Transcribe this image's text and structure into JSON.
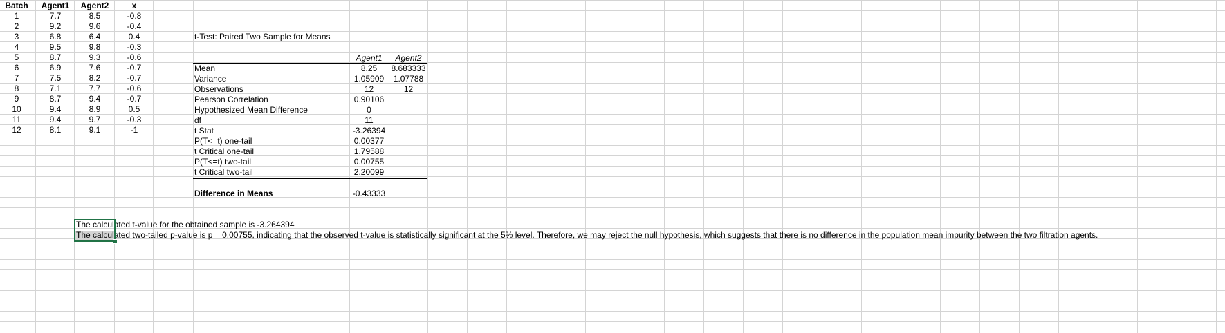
{
  "data_table": {
    "headers": [
      "Batch",
      "Agent1",
      "Agent2",
      "x"
    ],
    "rows": [
      [
        "1",
        "7.7",
        "8.5",
        "-0.8"
      ],
      [
        "2",
        "9.2",
        "9.6",
        "-0.4"
      ],
      [
        "3",
        "6.8",
        "6.4",
        "0.4"
      ],
      [
        "4",
        "9.5",
        "9.8",
        "-0.3"
      ],
      [
        "5",
        "8.7",
        "9.3",
        "-0.6"
      ],
      [
        "6",
        "6.9",
        "7.6",
        "-0.7"
      ],
      [
        "7",
        "7.5",
        "8.2",
        "-0.7"
      ],
      [
        "8",
        "7.1",
        "7.7",
        "-0.6"
      ],
      [
        "9",
        "8.7",
        "9.4",
        "-0.7"
      ],
      [
        "10",
        "9.4",
        "8.9",
        "0.5"
      ],
      [
        "11",
        "9.4",
        "9.7",
        "-0.3"
      ],
      [
        "12",
        "8.1",
        "9.1",
        "-1"
      ]
    ]
  },
  "ttest": {
    "title": "t-Test: Paired Two Sample for Means",
    "col1": "Agent1",
    "col2": "Agent2",
    "rows": [
      {
        "label": "Mean",
        "v1": "8.25",
        "v2": "8.683333"
      },
      {
        "label": "Variance",
        "v1": "1.05909",
        "v2": "1.07788"
      },
      {
        "label": "Observations",
        "v1": "12",
        "v2": "12"
      },
      {
        "label": "Pearson Correlation",
        "v1": "0.90106",
        "v2": ""
      },
      {
        "label": "Hypothesized Mean Difference",
        "v1": "0",
        "v2": ""
      },
      {
        "label": "df",
        "v1": "11",
        "v2": ""
      },
      {
        "label": "t Stat",
        "v1": "-3.26394",
        "v2": ""
      },
      {
        "label": "P(T<=t) one-tail",
        "v1": "0.00377",
        "v2": ""
      },
      {
        "label": "t Critical one-tail",
        "v1": "1.79588",
        "v2": ""
      },
      {
        "label": "P(T<=t) two-tail",
        "v1": "0.00755",
        "v2": ""
      },
      {
        "label": "t Critical two-tail",
        "v1": "2.20099",
        "v2": ""
      }
    ],
    "diff_label": "Difference in Means",
    "diff_value": "-0.43333"
  },
  "notes": {
    "line1": "The calculated t-value for the obtained sample is -3.264394",
    "line2": "The calculated two-tailed p-value is p = 0.00755, indicating that the observed t-value is statistically significant at the 5% level. Therefore, we may reject the null hypothesis, which suggests that there is no difference in the population mean impurity between the two filtration agents."
  },
  "colors": {
    "gridline": "#d4d4d4",
    "selection": "#217346",
    "highlight": "#d4d4d4"
  }
}
